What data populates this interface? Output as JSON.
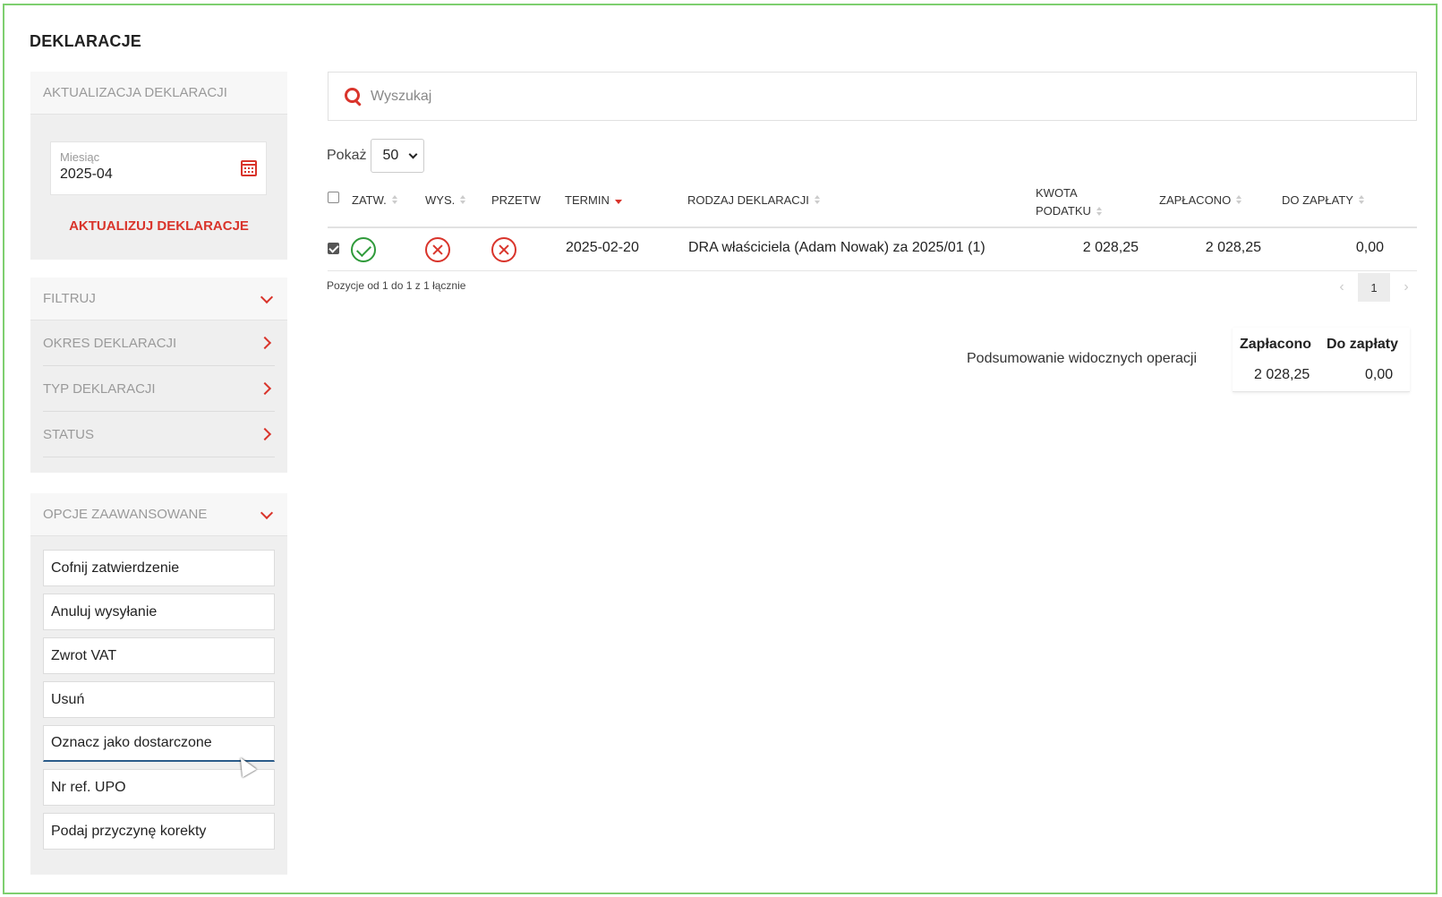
{
  "page_title": "DEKLARACJE",
  "update_panel": {
    "header": "AKTUALIZACJA DEKLARACJI",
    "month_label": "Miesiąc",
    "month_value": "2025-04",
    "update_link": "AKTUALIZUJ DEKLARACJE"
  },
  "filter_panel": {
    "header": "FILTRUJ",
    "items": [
      {
        "label": "OKRES DEKLARACJI"
      },
      {
        "label": "TYP DEKLARACJI"
      },
      {
        "label": "STATUS"
      }
    ]
  },
  "advanced_panel": {
    "header": "OPCJE ZAAWANSOWANE",
    "buttons": [
      {
        "label": "Cofnij zatwierdzenie"
      },
      {
        "label": "Anuluj wysyłanie"
      },
      {
        "label": "Zwrot VAT"
      },
      {
        "label": "Usuń"
      },
      {
        "label": "Oznacz jako dostarczone"
      },
      {
        "label": "Nr ref. UPO"
      },
      {
        "label": "Podaj przyczynę korekty"
      }
    ]
  },
  "search": {
    "placeholder": "Wyszukaj",
    "value": ""
  },
  "show": {
    "label": "Pokaż",
    "selected": "50"
  },
  "table": {
    "columns": {
      "zatw": "ZATW.",
      "wys": "WYS.",
      "przetw": "PRZETW",
      "termin": "TERMIN",
      "rodzaj": "RODZAJ DEKLARACJI",
      "kwota_line1": "KWOTA",
      "kwota_line2": "PODATKU",
      "zaplacono": "ZAPŁACONO",
      "do_zaplaty": "DO ZAPŁATY"
    },
    "rows": [
      {
        "checked": true,
        "zatw_status": "approved",
        "wys_status": "not-sent",
        "przetw_status": "not-processed",
        "termin": "2025-02-20",
        "rodzaj": "DRA właściciela (Adam Nowak) za 2025/01 (1)",
        "kwota": "2 028,25",
        "zaplacono": "2 028,25",
        "do_zaplaty": "0,00"
      }
    ],
    "info": "Pozycje od 1 do 1 z 1 łącznie",
    "pagination": {
      "prev": "‹",
      "current": "1",
      "next": "›"
    }
  },
  "summary": {
    "label": "Podsumowanie widocznych operacji",
    "paid_header": "Zapłacono",
    "due_header": "Do zapłaty",
    "paid_value": "2 028,25",
    "due_value": "0,00"
  },
  "colors": {
    "accent": "#d9342b",
    "success": "#2f9a3a",
    "frame": "#7ecf6f"
  }
}
